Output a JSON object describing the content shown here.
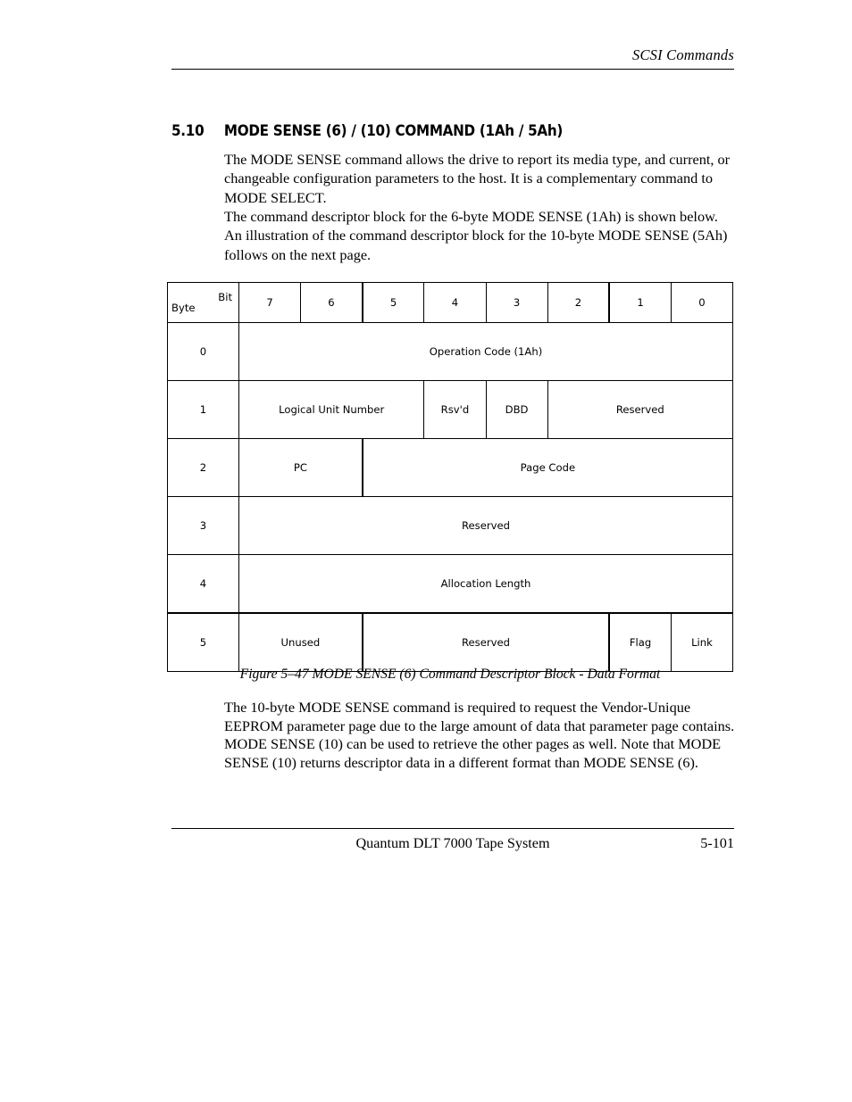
{
  "header": {
    "running_head": "SCSI Commands"
  },
  "section": {
    "number": "5.10",
    "title": "MODE SENSE  (6) / (10) COMMAND  (1Ah / 5Ah)"
  },
  "body": {
    "paragraph_1": "The MODE SENSE command allows the drive to report its media type, and current, or changeable configuration parameters to the host. It is a complementary command to MODE SELECT.",
    "paragraph_2": "The command descriptor block for the 6-byte MODE SENSE (1Ah) is shown below. An illustration of the command descriptor block for the 10-byte MODE SENSE (5Ah) follows on the next page.",
    "paragraph_3": "The 10-byte MODE SENSE command is required to request the Vendor-Unique EEPROM parameter page due to the large amount of data that parameter page contains. MODE SENSE (10) can be used to retrieve the other pages as well. Note that MODE SENSE (10) returns descriptor data in a different format than MODE SENSE (6)."
  },
  "cdb_table": {
    "corner": {
      "bit_label": "Bit",
      "byte_label": "Byte"
    },
    "bit_headers": [
      "7",
      "6",
      "5",
      "4",
      "3",
      "2",
      "1",
      "0"
    ],
    "rows": [
      {
        "byte": "0",
        "fields": [
          {
            "label": "Operation Code (1Ah)",
            "bits": 8
          }
        ]
      },
      {
        "byte": "1",
        "fields": [
          {
            "label": "Logical Unit Number",
            "bits": 3
          },
          {
            "label": "Rsv'd",
            "bits": 1
          },
          {
            "label": "DBD",
            "bits": 1
          },
          {
            "label": "Reserved",
            "bits": 3
          }
        ]
      },
      {
        "byte": "2",
        "fields": [
          {
            "label": "PC",
            "bits": 2
          },
          {
            "label": "Page Code",
            "bits": 6
          }
        ]
      },
      {
        "byte": "3",
        "fields": [
          {
            "label": "Reserved",
            "bits": 8
          }
        ]
      },
      {
        "byte": "4",
        "fields": [
          {
            "label": "Allocation Length",
            "bits": 8
          }
        ]
      },
      {
        "byte": "5",
        "fields": [
          {
            "label": "Unused",
            "bits": 2
          },
          {
            "label": "Reserved",
            "bits": 4
          },
          {
            "label": "Flag",
            "bits": 1
          },
          {
            "label": "Link",
            "bits": 1
          }
        ]
      }
    ]
  },
  "figure": {
    "caption": "Figure 5–47  MODE SENSE (6) Command Descriptor Block - Data Format"
  },
  "footer": {
    "title": "Quantum DLT 7000 Tape System",
    "page_number": "5-101"
  }
}
